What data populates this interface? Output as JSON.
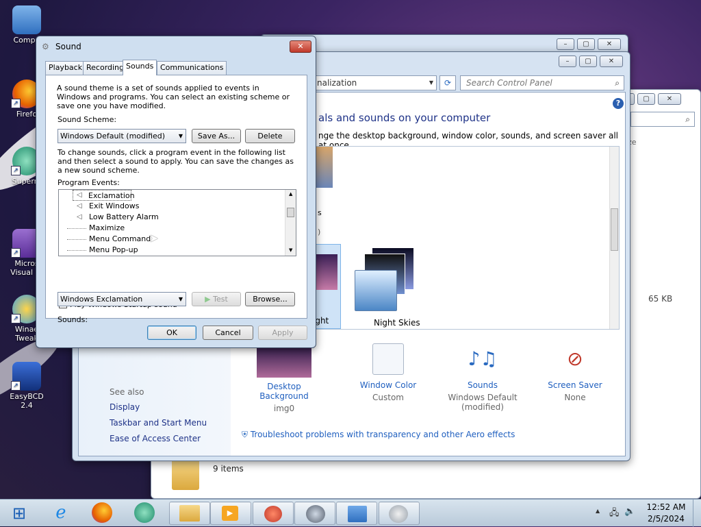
{
  "desktop": {
    "icons": [
      {
        "label": "Compu"
      },
      {
        "label": "Firefo"
      },
      {
        "label": "Superm"
      },
      {
        "label": "Micros Visual St"
      },
      {
        "label": "Winae Tweak"
      },
      {
        "label": "EasyBCD 2.4"
      }
    ]
  },
  "control_panel": {
    "address": "nalization",
    "search_placeholder": "Search Control Panel",
    "heading": "als and sounds on your computer",
    "subheading": "nge the desktop background, window color, sounds, and screen saver all at once.",
    "section_partial": "s",
    "section_count": ")",
    "theme_partial_label": "ight",
    "theme_label": "Night Skies",
    "see_also": {
      "title": "See also",
      "links": [
        "Display",
        "Taskbar and Start Menu",
        "Ease of Access Center"
      ]
    },
    "tiles": [
      {
        "title": "Desktop Background",
        "sub": "img0"
      },
      {
        "title": "Window Color",
        "sub": "Custom"
      },
      {
        "title": "Sounds",
        "sub": "Windows Default (modified)"
      },
      {
        "title": "Screen Saver",
        "sub": "None"
      }
    ],
    "troubleshoot": "Troubleshoot problems with transparency and other Aero effects"
  },
  "explorer": {
    "status": "9 items",
    "size": "65 KB",
    "partial": "ze"
  },
  "sound_dialog": {
    "title": "Sound",
    "tabs": [
      "Playback",
      "Recording",
      "Sounds",
      "Communications"
    ],
    "active_tab": "Sounds",
    "intro": "A sound theme is a set of sounds applied to events in Windows and programs.  You can select an existing scheme or save one you have modified.",
    "scheme_label": "Sound Scheme:",
    "scheme_value": "Windows Default (modified)",
    "save_as": "Save As...",
    "delete": "Delete",
    "change_text": "To change sounds, click a program event in the following list and then select a sound to apply.  You can save the changes as a new sound scheme.",
    "events_label": "Program Events:",
    "events": [
      {
        "name": "Exclamation",
        "has_sound": true
      },
      {
        "name": "Exit Windows",
        "has_sound": true
      },
      {
        "name": "Low Battery Alarm",
        "has_sound": true
      },
      {
        "name": "Maximize",
        "has_sound": false
      },
      {
        "name": "Menu Command",
        "has_sound": false
      },
      {
        "name": "Menu Pop-up",
        "has_sound": false
      }
    ],
    "startup_label": "Play Windows Startup sound",
    "startup_checked": true,
    "sounds_label": "Sounds:",
    "sounds_value": "Windows Exclamation",
    "test": "Test",
    "browse": "Browse...",
    "ok": "OK",
    "cancel": "Cancel",
    "apply": "Apply"
  },
  "taskbar": {
    "time": "12:52 AM",
    "date": "2/5/2024"
  },
  "colors": {
    "link": "#1f5fbf",
    "dialog_bg": "#cfdff0",
    "taskbar": "#c8d7e6"
  }
}
